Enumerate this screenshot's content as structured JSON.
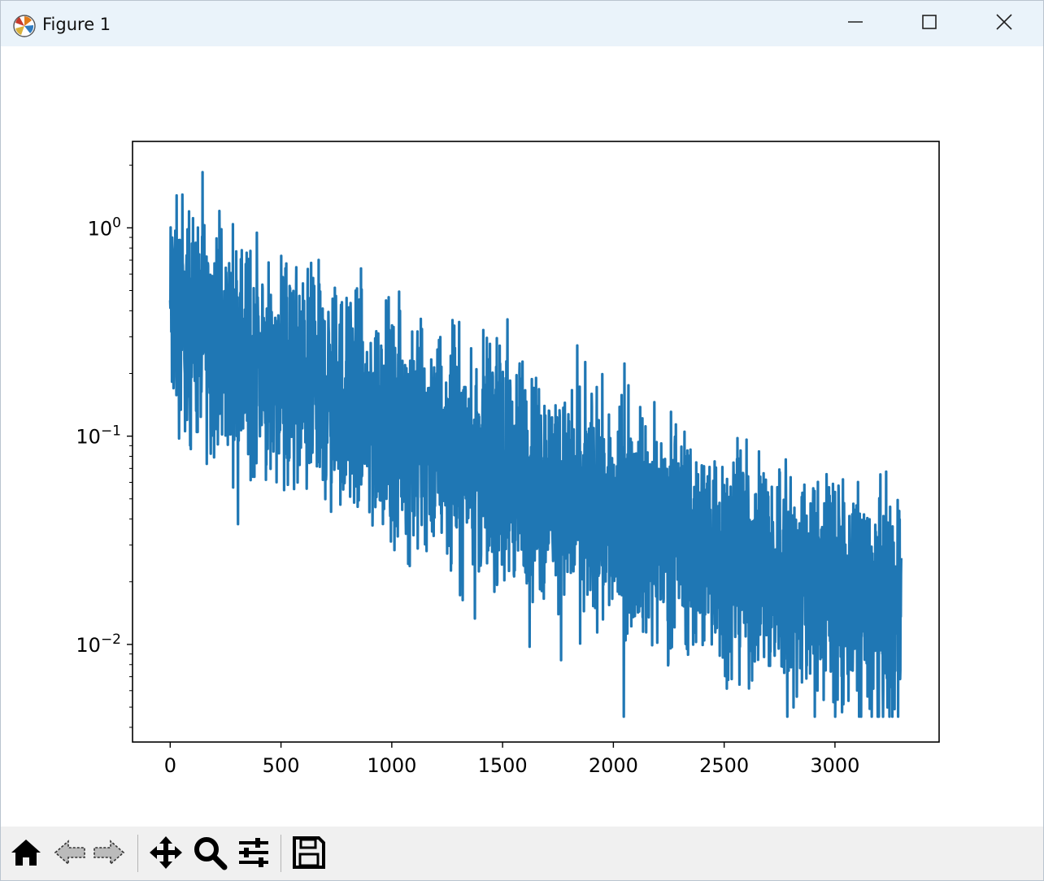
{
  "window": {
    "title": "Figure 1",
    "app_icon": "matplotlib-icon",
    "controls": [
      "minimize-icon",
      "maximize-icon",
      "close-icon"
    ]
  },
  "toolbar": {
    "tools": [
      "home-icon",
      "back-arrow-icon",
      "forward-arrow-icon",
      "pan-move-icon",
      "zoom-magnifier-icon",
      "configure-subplots-icon",
      "save-floppy-icon"
    ]
  },
  "chart_data": {
    "type": "line",
    "title": "",
    "xlabel": "",
    "ylabel": "",
    "xscale": "linear",
    "yscale": "log",
    "xlim": [
      -170,
      3470
    ],
    "ylim": [
      0.0034,
      2.6
    ],
    "x_ticks": [
      0,
      500,
      1000,
      1500,
      2000,
      2500,
      3000
    ],
    "x_tick_labels": [
      "0",
      "500",
      "1000",
      "1500",
      "2000",
      "2500",
      "3000"
    ],
    "y_ticks": [
      1,
      0.1,
      0.01
    ],
    "y_tick_labels": [
      {
        "base": "10",
        "exp": "0"
      },
      {
        "base": "10",
        "exp": "−1"
      },
      {
        "base": "10",
        "exp": "−2"
      }
    ],
    "grid": false,
    "legend": "none",
    "line_color": "#1f77b4",
    "series": [
      {
        "x_start": 0,
        "x_end": 3300,
        "n_points": 3300,
        "trend_start": 0.85,
        "trend_end": 0.028,
        "noise_log10_range": [
          -1.0,
          0.55
        ],
        "max_value": 1.85,
        "min_value": 0.0045
      }
    ]
  }
}
